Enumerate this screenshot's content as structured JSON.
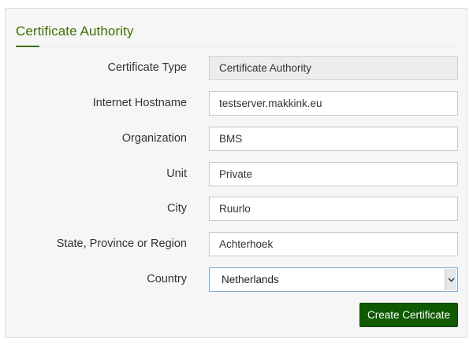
{
  "panel": {
    "title": "Certificate Authority"
  },
  "form": {
    "certificate_type": {
      "label": "Certificate Type",
      "value": "Certificate Authority"
    },
    "internet_hostname": {
      "label": "Internet Hostname",
      "value": "testserver.makkink.eu"
    },
    "organization": {
      "label": "Organization",
      "value": "BMS"
    },
    "unit": {
      "label": "Unit",
      "value": "Private"
    },
    "city": {
      "label": "City",
      "value": "Ruurlo"
    },
    "state": {
      "label": "State, Province or Region",
      "value": "Achterhoek"
    },
    "country": {
      "label": "Country",
      "selected": "Netherlands",
      "icon": "chevron-down-icon"
    }
  },
  "actions": {
    "create_label": "Create Certificate"
  },
  "colors": {
    "title": "#3f6f00",
    "button": "#0f5a00",
    "select_border": "#7aa7d8"
  }
}
